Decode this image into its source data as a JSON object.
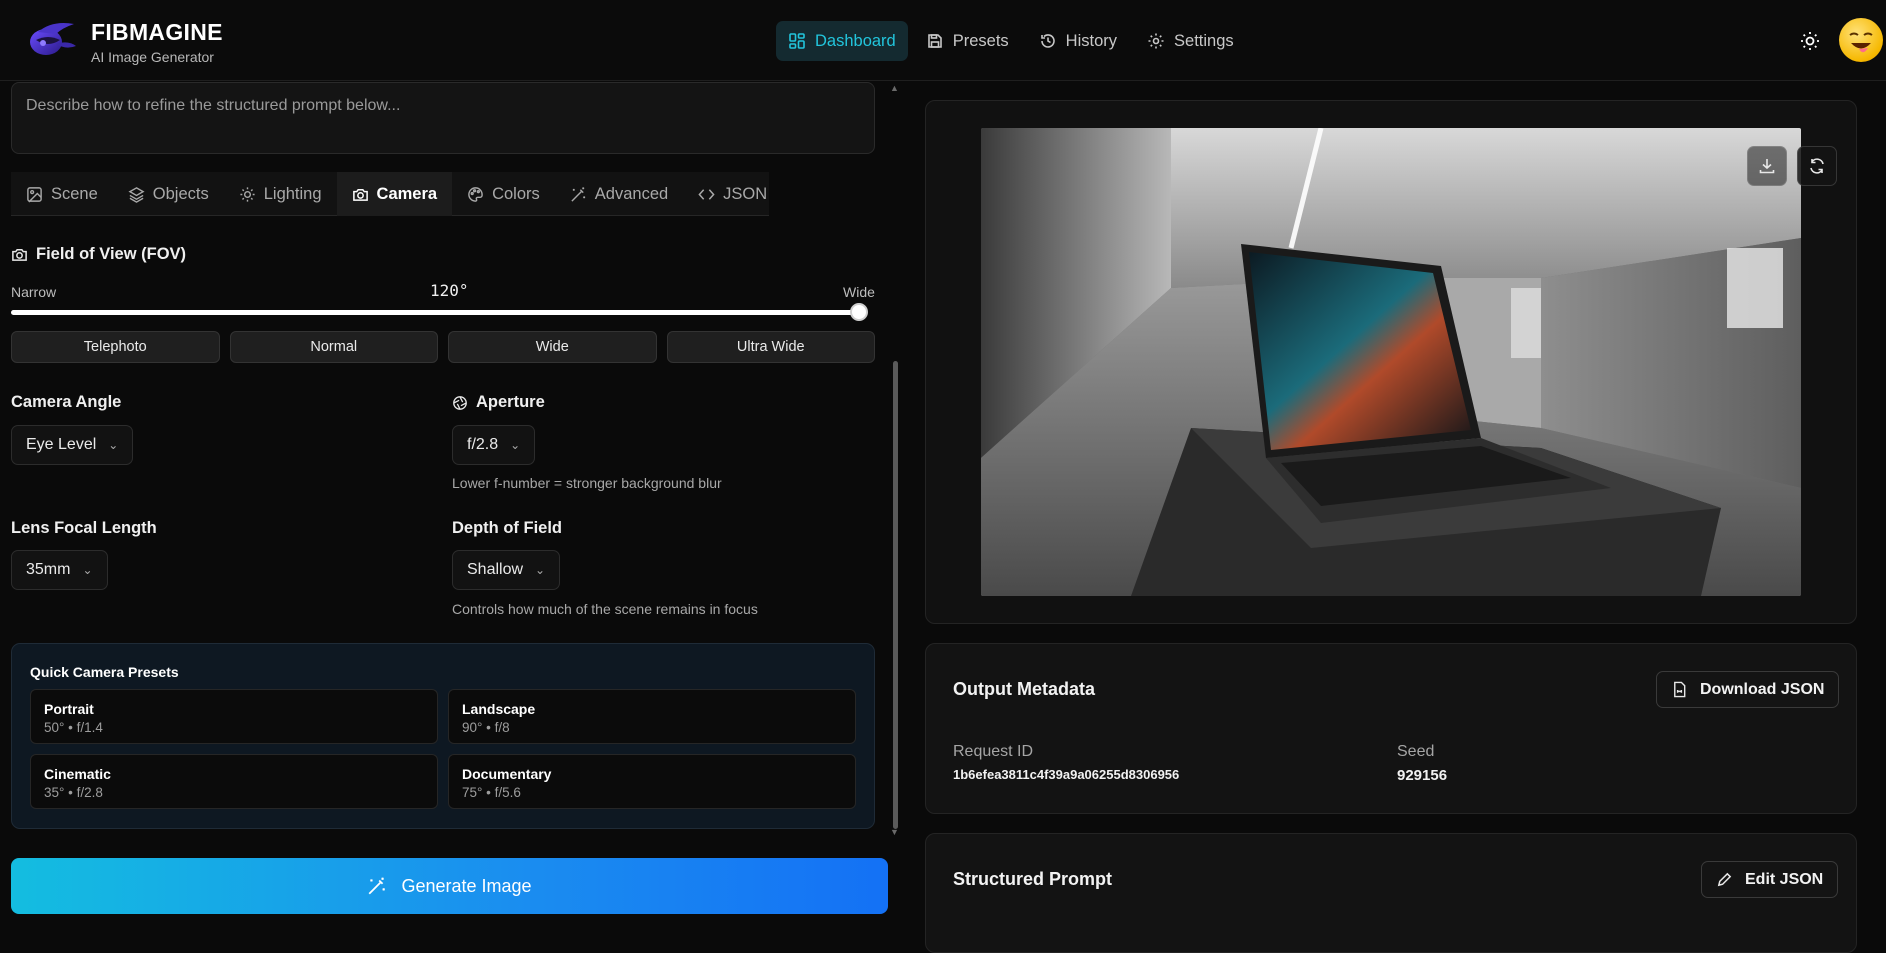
{
  "brand": {
    "title": "FIBMAGINE",
    "subtitle": "AI Image Generator"
  },
  "nav": {
    "items": [
      {
        "label": "Dashboard",
        "icon": "dashboard-icon",
        "active": true
      },
      {
        "label": "Presets",
        "icon": "save-icon",
        "active": false
      },
      {
        "label": "History",
        "icon": "history-icon",
        "active": false
      },
      {
        "label": "Settings",
        "icon": "gear-icon",
        "active": false
      }
    ]
  },
  "refine": {
    "placeholder": "Describe how to refine the structured prompt below..."
  },
  "tabs": [
    {
      "label": "Scene",
      "icon": "image-icon",
      "active": false
    },
    {
      "label": "Objects",
      "icon": "layers-icon",
      "active": false
    },
    {
      "label": "Lighting",
      "icon": "sun-icon",
      "active": false
    },
    {
      "label": "Camera",
      "icon": "camera-icon",
      "active": true
    },
    {
      "label": "Colors",
      "icon": "palette-icon",
      "active": false
    },
    {
      "label": "Advanced",
      "icon": "wand-icon",
      "active": false
    },
    {
      "label": "JSON",
      "icon": "code-icon",
      "active": false
    }
  ],
  "fov": {
    "title": "Field of View (FOV)",
    "min_label": "Narrow",
    "max_label": "Wide",
    "value_text": "120°",
    "value_fraction": 1.0,
    "buttons": [
      "Telephoto",
      "Normal",
      "Wide",
      "Ultra Wide"
    ]
  },
  "camera_angle": {
    "label": "Camera Angle",
    "value": "Eye Level"
  },
  "aperture": {
    "label": "Aperture",
    "value": "f/2.8",
    "help": "Lower f-number = stronger background blur"
  },
  "focal_length": {
    "label": "Lens Focal Length",
    "value": "35mm"
  },
  "depth_of_field": {
    "label": "Depth of Field",
    "value": "Shallow",
    "help": "Controls how much of the scene remains in focus"
  },
  "quick_presets": {
    "title": "Quick Camera Presets",
    "items": [
      {
        "name": "Portrait",
        "value": "50° • f/1.4"
      },
      {
        "name": "Landscape",
        "value": "90° • f/8"
      },
      {
        "name": "Cinematic",
        "value": "35° • f/2.8"
      },
      {
        "name": "Documentary",
        "value": "75° • f/5.6"
      }
    ]
  },
  "generate": {
    "label": "Generate Image"
  },
  "output": {
    "title": "Output Metadata",
    "download_label": "Download JSON",
    "request_id_label": "Request ID",
    "request_id": "1b6efea3811c4f39a9a06255d8306956",
    "seed_label": "Seed",
    "seed": "929156"
  },
  "structured_prompt": {
    "title": "Structured Prompt",
    "edit_label": "Edit JSON"
  },
  "colors": {
    "accent": "#22c5dc",
    "generate_gradient_start": "#14bde0",
    "generate_gradient_end": "#1471f5"
  }
}
